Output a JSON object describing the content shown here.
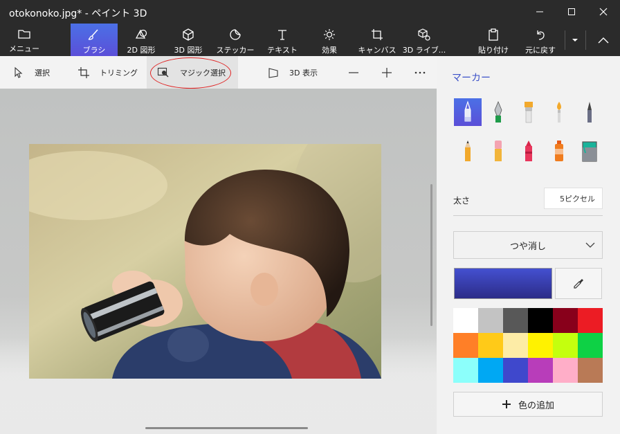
{
  "window": {
    "title": "otokonoko.jpg* - ペイント 3D",
    "minimize_glyph": "—",
    "maximize_glyph": "☐",
    "close_glyph": "✕"
  },
  "ribbon": {
    "menu_label": "メニュー",
    "tools": [
      {
        "label": "ブラシ",
        "icon": "brush-icon"
      },
      {
        "label": "2D 図形",
        "icon": "2d-shapes-icon"
      },
      {
        "label": "3D 図形",
        "icon": "3d-shapes-icon"
      },
      {
        "label": "ステッカー",
        "icon": "sticker-icon"
      },
      {
        "label": "テキスト",
        "icon": "text-icon"
      },
      {
        "label": "効果",
        "icon": "effects-icon"
      },
      {
        "label": "キャンバス",
        "icon": "canvas-icon"
      },
      {
        "label": "3D ライブ...",
        "icon": "3d-library-icon"
      }
    ],
    "paste_label": "貼り付け",
    "undo_label": "元に戻す"
  },
  "subtoolbar": {
    "select_label": "選択",
    "crop_label": "トリミング",
    "magic_select_label": "マジック選択",
    "view3d_label": "3D 表示",
    "zoom_out_glyph": "—",
    "zoom_in_glyph": "+",
    "more_glyph": "···"
  },
  "panel": {
    "title": "マーカー",
    "brushes": [
      {
        "name": "marker",
        "icon": "marker-icon"
      },
      {
        "name": "calligraphy-pen",
        "icon": "calligraphy-pen-icon"
      },
      {
        "name": "oil-brush",
        "icon": "oil-brush-icon"
      },
      {
        "name": "watercolor",
        "icon": "watercolor-icon"
      },
      {
        "name": "pixel-pen",
        "icon": "pixel-pen-icon"
      },
      {
        "name": "pencil",
        "icon": "pencil-icon"
      },
      {
        "name": "eraser",
        "icon": "eraser-icon"
      },
      {
        "name": "crayon",
        "icon": "crayon-icon"
      },
      {
        "name": "spray-can",
        "icon": "spray-can-icon"
      },
      {
        "name": "fill",
        "icon": "fill-bucket-icon"
      }
    ],
    "thickness_label": "太さ",
    "thickness_value": "5ピクセル",
    "finish_value": "つや消し",
    "current_color": "#4450d0",
    "palette": [
      "#ffffff",
      "#c3c3c3",
      "#585858",
      "#000000",
      "#88001b",
      "#ec1c24",
      "#ff7f27",
      "#ffca18",
      "#fdeca6",
      "#fff200",
      "#c4ff0e",
      "#0ed145",
      "#8cfffb",
      "#00a8f3",
      "#3f48cc",
      "#b83dba",
      "#ffaec8",
      "#b97a56"
    ],
    "add_color_label": "色の追加"
  }
}
